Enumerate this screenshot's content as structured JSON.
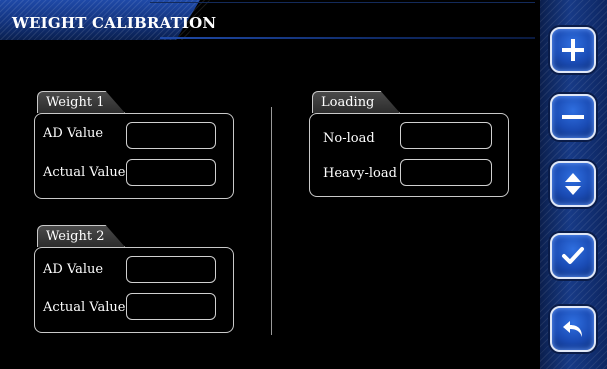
{
  "title": "WEIGHT CALIBRATION",
  "groups": {
    "weight1": {
      "label": "Weight 1",
      "ad_label": "AD Value",
      "ad_value": "",
      "actual_label": "Actual Value",
      "actual_value": ""
    },
    "weight2": {
      "label": "Weight 2",
      "ad_label": "AD Value",
      "ad_value": "",
      "actual_label": "Actual Value",
      "actual_value": ""
    },
    "loading": {
      "label": "Loading",
      "noload_label": "No-load",
      "noload_value": "",
      "heavy_label": "Heavy-load",
      "heavy_value": ""
    }
  },
  "side_buttons": [
    {
      "name": "plus-button",
      "icon": "plus-icon"
    },
    {
      "name": "minus-button",
      "icon": "minus-icon"
    },
    {
      "name": "up-down-button",
      "icon": "up-down-arrows-icon"
    },
    {
      "name": "confirm-button",
      "icon": "checkmark-icon"
    },
    {
      "name": "back-button",
      "icon": "return-arrow-icon"
    }
  ],
  "colors": {
    "accent": "#1a4bb4",
    "panel": "#173a86",
    "background": "#000000",
    "border": "#c9c9c9"
  }
}
